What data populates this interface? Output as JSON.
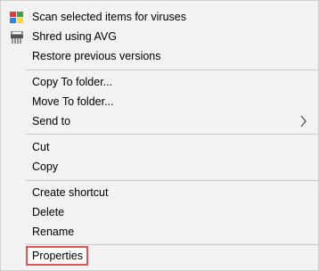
{
  "menu": {
    "items": [
      {
        "label": "Scan selected items for viruses",
        "icon": "avg-antivirus-icon"
      },
      {
        "label": "Shred using AVG",
        "icon": "shredder-icon"
      },
      {
        "label": "Restore previous versions"
      },
      {
        "label": "Copy To folder..."
      },
      {
        "label": "Move To folder..."
      },
      {
        "label": "Send to",
        "has_submenu": true
      },
      {
        "label": "Cut"
      },
      {
        "label": "Copy"
      },
      {
        "label": "Create shortcut"
      },
      {
        "label": "Delete"
      },
      {
        "label": "Rename"
      },
      {
        "label": "Properties",
        "highlighted": true
      }
    ]
  },
  "colors": {
    "menu_background": "#f2f2f2",
    "separator": "#c8c8c8",
    "highlight_border": "#e05555"
  }
}
